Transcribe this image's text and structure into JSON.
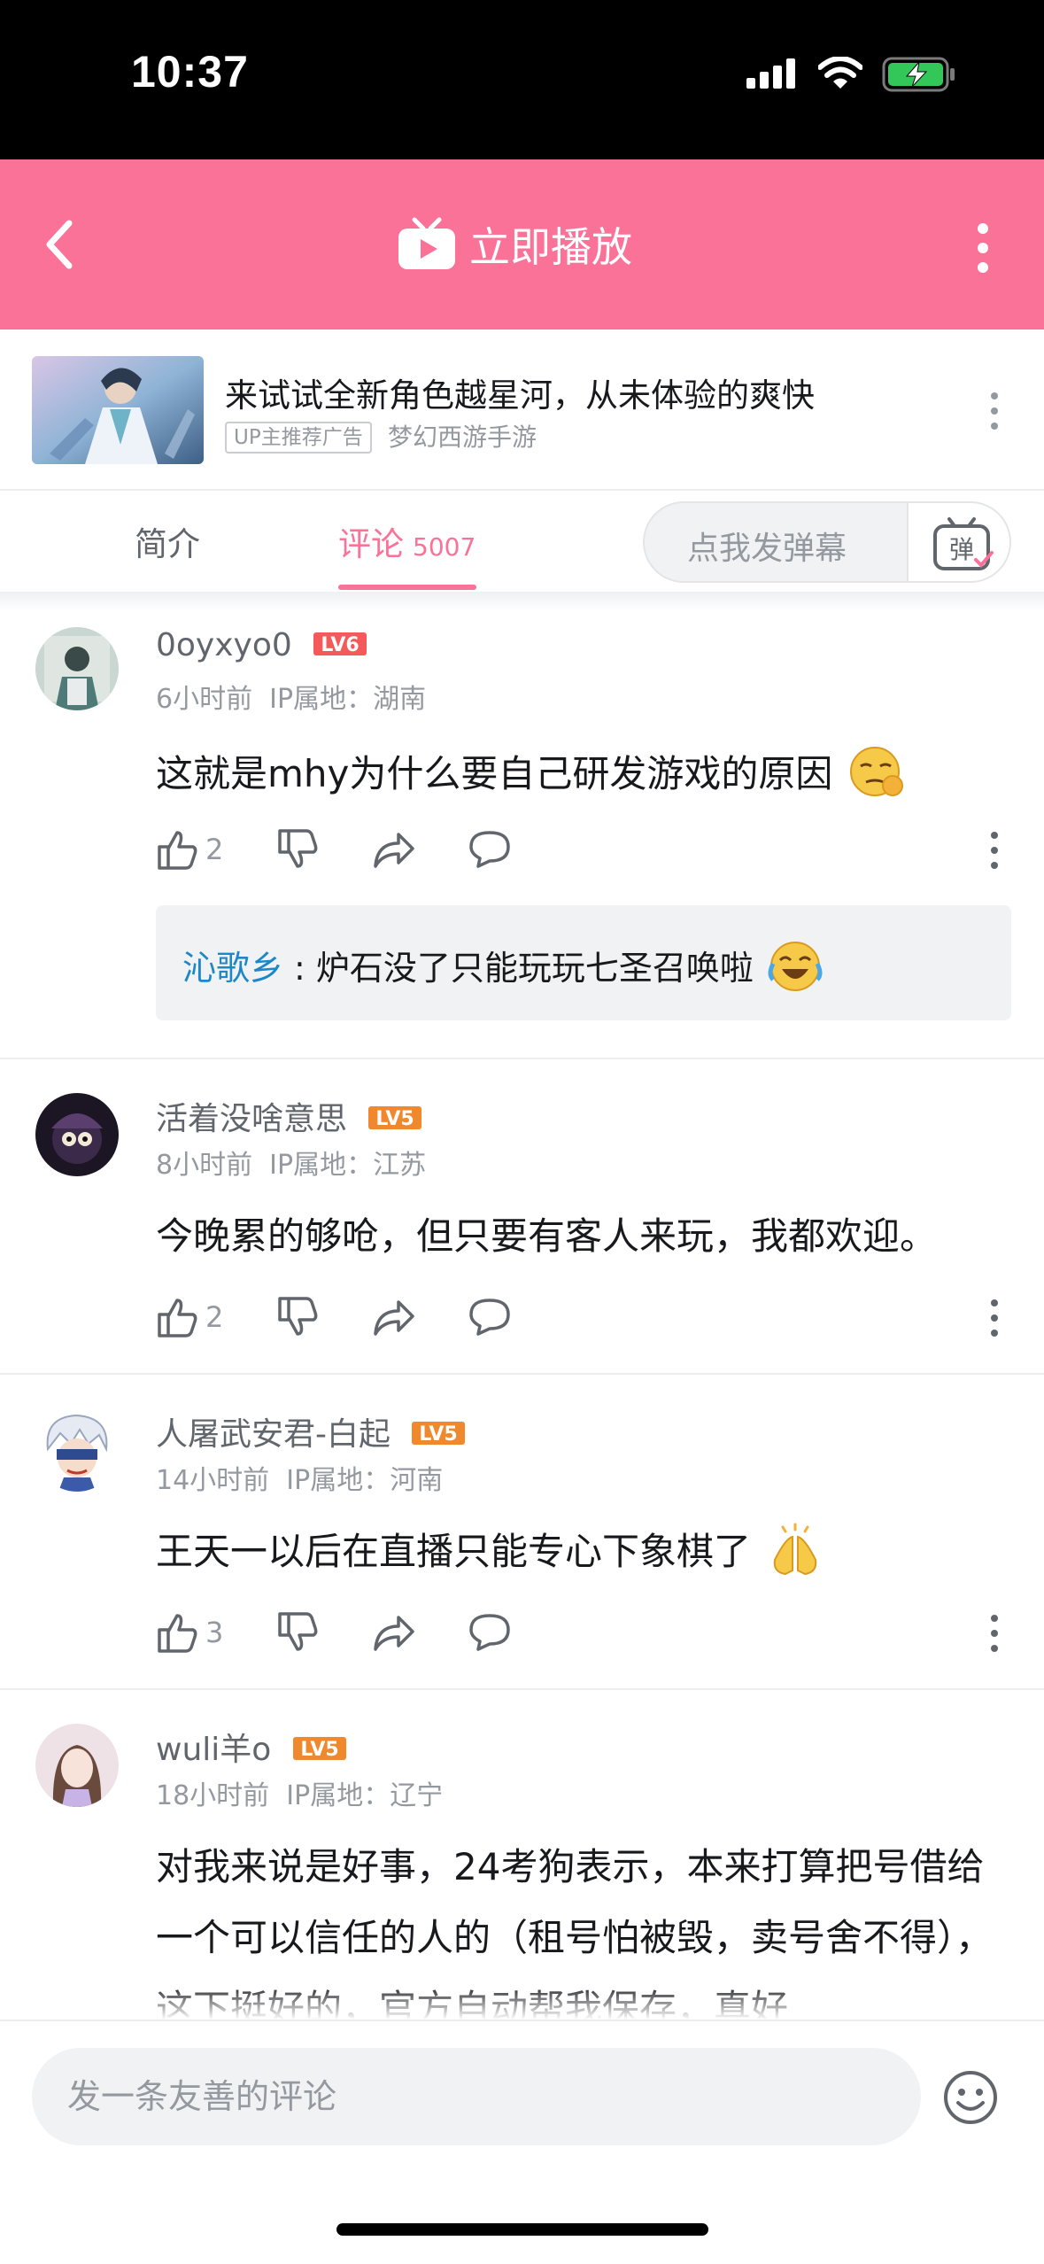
{
  "status_bar": {
    "time": "10:37"
  },
  "header": {
    "title": "立即播放"
  },
  "ad": {
    "title": "来试试全新角色越星河，从未体验的爽快",
    "badge": "UP主推荐广告",
    "source": "梦幻西游手游"
  },
  "tabs": {
    "intro": "简介",
    "comments": "评论",
    "comments_count": "5007",
    "danmaku_placeholder": "点我发弹幕",
    "danmaku_icon_label": "弹"
  },
  "comments": [
    {
      "username": "0oyxyo0",
      "level": "LV6",
      "time": "6小时前",
      "ip": "IP属地：湖南",
      "content": "这就是mhy为什么要自己研发游戏的原因",
      "likes": "2",
      "reply": {
        "name": "沁歌乡",
        "text": ": 炉石没了只能玩玩七圣召唤啦"
      }
    },
    {
      "username": "活着没啥意思",
      "level": "LV5",
      "time": "8小时前",
      "ip": "IP属地：江苏",
      "content": "今晚累的够呛，但只要有客人来玩，我都欢迎。",
      "likes": "2"
    },
    {
      "username": "人屠武安君-白起",
      "level": "LV5",
      "time": "14小时前",
      "ip": "IP属地：河南",
      "content": "王天一以后在直播只能专心下象棋了",
      "likes": "3"
    },
    {
      "username": "wuli羊o",
      "level": "LV5",
      "time": "18小时前",
      "ip": "IP属地：辽宁",
      "content": "对我来说是好事，24考狗表示，本来打算把号借给一个可以信任的人的（租号怕被毁，卖号舍不得），这下挺好的，官方自动帮我保存，真好"
    }
  ],
  "bottom": {
    "input_placeholder": "发一条友善的评论"
  },
  "colors": {
    "brand_pink": "#fb7299",
    "lv6": "#f45a5a",
    "lv5": "#f0882e",
    "reply_name": "#1e88c7"
  }
}
